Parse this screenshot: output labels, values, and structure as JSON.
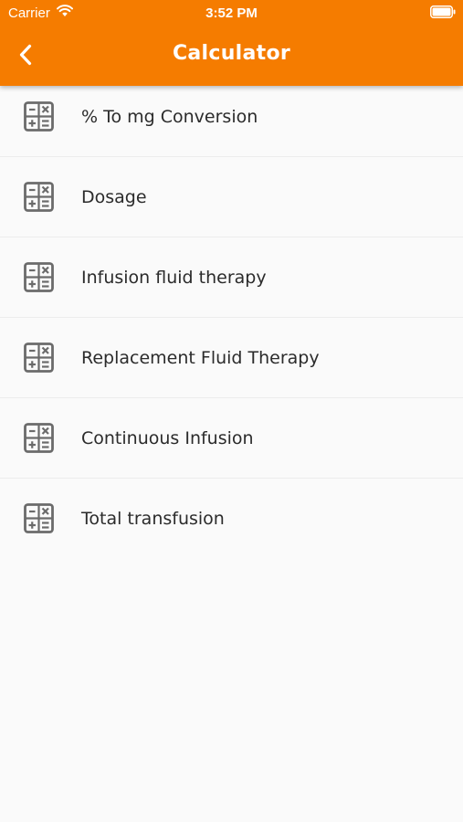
{
  "status_bar": {
    "carrier": "Carrier",
    "time": "3:52 PM"
  },
  "header": {
    "title": "Calculator",
    "background_color": "#f57c00",
    "back_icon": "chevron-left-icon"
  },
  "list": {
    "icon": "calculator-icon",
    "items": [
      {
        "label": "% To mg Conversion"
      },
      {
        "label": "Dosage"
      },
      {
        "label": "Infusion fluid therapy"
      },
      {
        "label": "Replacement Fluid Therapy"
      },
      {
        "label": "Continuous Infusion"
      },
      {
        "label": "Total transfusion"
      }
    ]
  }
}
